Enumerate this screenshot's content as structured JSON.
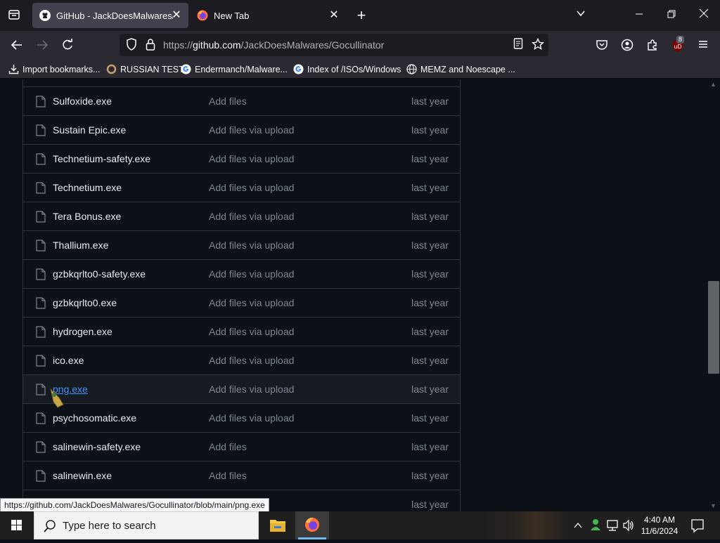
{
  "browser": {
    "tabs": [
      {
        "title": "GitHub - JackDoesMalwares/Gocullinator",
        "active": true
      },
      {
        "title": "New Tab",
        "active": false
      }
    ],
    "url": {
      "prefix": "https://",
      "host": "github.com",
      "path": "/JackDoesMalwares/Gocullinator"
    },
    "extension_badge": "8",
    "bookmarks": [
      {
        "label": "Import bookmarks...",
        "icon": "import-icon"
      },
      {
        "label": "RUSSIAN TEST",
        "icon": "ring-icon"
      },
      {
        "label": "Endermanch/Malware...",
        "icon": "google-icon"
      },
      {
        "label": "Index of /ISOs/Windows",
        "icon": "google-icon"
      },
      {
        "label": "MEMZ and Noescape ...",
        "icon": "globe-icon"
      }
    ]
  },
  "files": [
    {
      "name": "Sulfoxide.exe",
      "commit": "Add files",
      "age": "last year"
    },
    {
      "name": "Sustain Epic.exe",
      "commit": "Add files via upload",
      "age": "last year"
    },
    {
      "name": "Technetium-safety.exe",
      "commit": "Add files via upload",
      "age": "last year"
    },
    {
      "name": "Technetium.exe",
      "commit": "Add files via upload",
      "age": "last year"
    },
    {
      "name": "Tera Bonus.exe",
      "commit": "Add files via upload",
      "age": "last year"
    },
    {
      "name": "Thallium.exe",
      "commit": "Add files via upload",
      "age": "last year"
    },
    {
      "name": "gzbkqrlto0-safety.exe",
      "commit": "Add files via upload",
      "age": "last year"
    },
    {
      "name": "gzbkqrlto0.exe",
      "commit": "Add files via upload",
      "age": "last year"
    },
    {
      "name": "hydrogen.exe",
      "commit": "Add files via upload",
      "age": "last year"
    },
    {
      "name": "ico.exe",
      "commit": "Add files via upload",
      "age": "last year"
    },
    {
      "name": "png.exe",
      "commit": "Add files via upload",
      "age": "last year",
      "hovered": true
    },
    {
      "name": "psychosomatic.exe",
      "commit": "Add files via upload",
      "age": "last year"
    },
    {
      "name": "salinewin-safety.exe",
      "commit": "Add files",
      "age": "last year"
    },
    {
      "name": "salinewin.exe",
      "commit": "Add files",
      "age": "last year"
    },
    {
      "name": "",
      "commit": "",
      "age": "last year"
    }
  ],
  "status_link": "https://github.com/JackDoesMalwares/Gocullinator/blob/main/png.exe",
  "taskbar": {
    "search_placeholder": "Type here to search",
    "time": "4:40 AM",
    "date": "11/6/2024"
  },
  "colors": {
    "page_bg": "#0d1117",
    "border": "#30363d",
    "muted_text": "#7d8590",
    "link": "#4493f8",
    "browser_chrome": "#2b2a33"
  }
}
